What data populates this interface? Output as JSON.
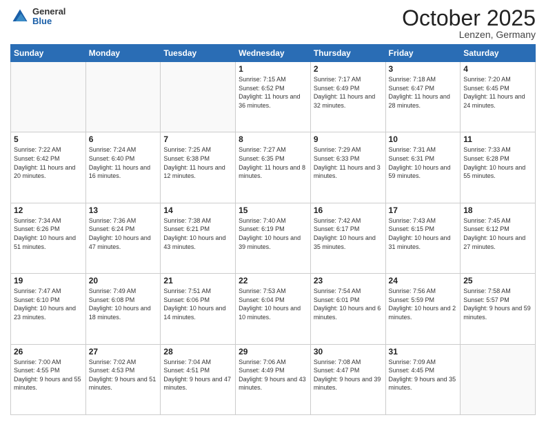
{
  "header": {
    "logo": {
      "general": "General",
      "blue": "Blue"
    },
    "title": "October 2025",
    "location": "Lenzen, Germany"
  },
  "calendar": {
    "weekdays": [
      "Sunday",
      "Monday",
      "Tuesday",
      "Wednesday",
      "Thursday",
      "Friday",
      "Saturday"
    ],
    "weeks": [
      [
        {
          "day": "",
          "sunrise": "",
          "sunset": "",
          "daylight": ""
        },
        {
          "day": "",
          "sunrise": "",
          "sunset": "",
          "daylight": ""
        },
        {
          "day": "",
          "sunrise": "",
          "sunset": "",
          "daylight": ""
        },
        {
          "day": "1",
          "sunrise": "7:15 AM",
          "sunset": "6:52 PM",
          "daylight": "11 hours and 36 minutes."
        },
        {
          "day": "2",
          "sunrise": "7:17 AM",
          "sunset": "6:49 PM",
          "daylight": "11 hours and 32 minutes."
        },
        {
          "day": "3",
          "sunrise": "7:18 AM",
          "sunset": "6:47 PM",
          "daylight": "11 hours and 28 minutes."
        },
        {
          "day": "4",
          "sunrise": "7:20 AM",
          "sunset": "6:45 PM",
          "daylight": "11 hours and 24 minutes."
        }
      ],
      [
        {
          "day": "5",
          "sunrise": "7:22 AM",
          "sunset": "6:42 PM",
          "daylight": "11 hours and 20 minutes."
        },
        {
          "day": "6",
          "sunrise": "7:24 AM",
          "sunset": "6:40 PM",
          "daylight": "11 hours and 16 minutes."
        },
        {
          "day": "7",
          "sunrise": "7:25 AM",
          "sunset": "6:38 PM",
          "daylight": "11 hours and 12 minutes."
        },
        {
          "day": "8",
          "sunrise": "7:27 AM",
          "sunset": "6:35 PM",
          "daylight": "11 hours and 8 minutes."
        },
        {
          "day": "9",
          "sunrise": "7:29 AM",
          "sunset": "6:33 PM",
          "daylight": "11 hours and 3 minutes."
        },
        {
          "day": "10",
          "sunrise": "7:31 AM",
          "sunset": "6:31 PM",
          "daylight": "10 hours and 59 minutes."
        },
        {
          "day": "11",
          "sunrise": "7:33 AM",
          "sunset": "6:28 PM",
          "daylight": "10 hours and 55 minutes."
        }
      ],
      [
        {
          "day": "12",
          "sunrise": "7:34 AM",
          "sunset": "6:26 PM",
          "daylight": "10 hours and 51 minutes."
        },
        {
          "day": "13",
          "sunrise": "7:36 AM",
          "sunset": "6:24 PM",
          "daylight": "10 hours and 47 minutes."
        },
        {
          "day": "14",
          "sunrise": "7:38 AM",
          "sunset": "6:21 PM",
          "daylight": "10 hours and 43 minutes."
        },
        {
          "day": "15",
          "sunrise": "7:40 AM",
          "sunset": "6:19 PM",
          "daylight": "10 hours and 39 minutes."
        },
        {
          "day": "16",
          "sunrise": "7:42 AM",
          "sunset": "6:17 PM",
          "daylight": "10 hours and 35 minutes."
        },
        {
          "day": "17",
          "sunrise": "7:43 AM",
          "sunset": "6:15 PM",
          "daylight": "10 hours and 31 minutes."
        },
        {
          "day": "18",
          "sunrise": "7:45 AM",
          "sunset": "6:12 PM",
          "daylight": "10 hours and 27 minutes."
        }
      ],
      [
        {
          "day": "19",
          "sunrise": "7:47 AM",
          "sunset": "6:10 PM",
          "daylight": "10 hours and 23 minutes."
        },
        {
          "day": "20",
          "sunrise": "7:49 AM",
          "sunset": "6:08 PM",
          "daylight": "10 hours and 18 minutes."
        },
        {
          "day": "21",
          "sunrise": "7:51 AM",
          "sunset": "6:06 PM",
          "daylight": "10 hours and 14 minutes."
        },
        {
          "day": "22",
          "sunrise": "7:53 AM",
          "sunset": "6:04 PM",
          "daylight": "10 hours and 10 minutes."
        },
        {
          "day": "23",
          "sunrise": "7:54 AM",
          "sunset": "6:01 PM",
          "daylight": "10 hours and 6 minutes."
        },
        {
          "day": "24",
          "sunrise": "7:56 AM",
          "sunset": "5:59 PM",
          "daylight": "10 hours and 2 minutes."
        },
        {
          "day": "25",
          "sunrise": "7:58 AM",
          "sunset": "5:57 PM",
          "daylight": "9 hours and 59 minutes."
        }
      ],
      [
        {
          "day": "26",
          "sunrise": "7:00 AM",
          "sunset": "4:55 PM",
          "daylight": "9 hours and 55 minutes."
        },
        {
          "day": "27",
          "sunrise": "7:02 AM",
          "sunset": "4:53 PM",
          "daylight": "9 hours and 51 minutes."
        },
        {
          "day": "28",
          "sunrise": "7:04 AM",
          "sunset": "4:51 PM",
          "daylight": "9 hours and 47 minutes."
        },
        {
          "day": "29",
          "sunrise": "7:06 AM",
          "sunset": "4:49 PM",
          "daylight": "9 hours and 43 minutes."
        },
        {
          "day": "30",
          "sunrise": "7:08 AM",
          "sunset": "4:47 PM",
          "daylight": "9 hours and 39 minutes."
        },
        {
          "day": "31",
          "sunrise": "7:09 AM",
          "sunset": "4:45 PM",
          "daylight": "9 hours and 35 minutes."
        },
        {
          "day": "",
          "sunrise": "",
          "sunset": "",
          "daylight": ""
        }
      ]
    ]
  }
}
